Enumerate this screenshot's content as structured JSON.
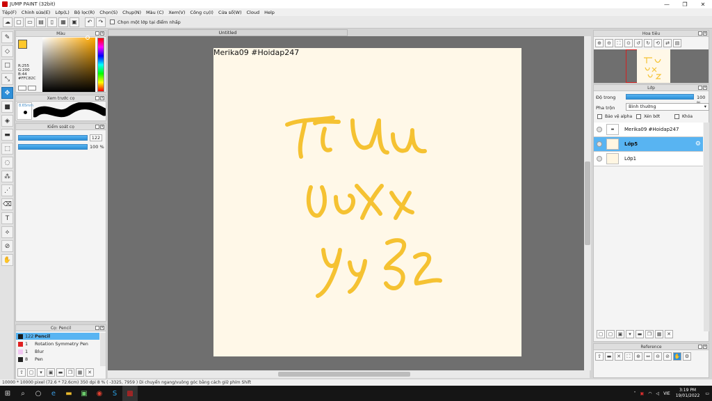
{
  "window": {
    "title": "JUMP PAINT (32bit)",
    "minimize": "—",
    "maximize": "❐",
    "close": "✕"
  },
  "menu": [
    "Tệp(F)",
    "Chỉnh sửa(E)",
    "Lớp(L)",
    "Bộ lọc(R)",
    "Chọn(S)",
    "Chụp(N)",
    "Màu (C)",
    "Xem(V)",
    "Công cụ(I)",
    "Cửa sổ(W)",
    "Cloud",
    "Help"
  ],
  "toolbar": {
    "checkbox_label": "Chọn một lớp tại điểm nhấp"
  },
  "color_panel": {
    "title": "Màu",
    "readout": [
      "R:255",
      "G:200",
      "B:44",
      "#FFC82C"
    ],
    "current_color": "#FFC82C"
  },
  "brush_preview": {
    "title": "Xem trước cọ",
    "size_label": "8.65mm"
  },
  "brush_control": {
    "title": "Kiểm soát cọ",
    "size_value": "122",
    "size_fraction": 0.95,
    "opacity_value": "100 %",
    "opacity_fraction": 1.0
  },
  "brush_list": {
    "title": "Cọ: Pencil",
    "items": [
      {
        "size": "122",
        "name": "Pencil",
        "color": "#1a1a1a",
        "selected": true
      },
      {
        "size": "1",
        "name": "Rotation Symmetry Pen",
        "color": "#e02020",
        "selected": false
      },
      {
        "size": "1",
        "name": "Blur",
        "color": "#f2c6f2",
        "selected": false
      },
      {
        "size": "8",
        "name": "Pen",
        "color": "#222222",
        "selected": false
      }
    ]
  },
  "document": {
    "tab_title": "Untitled",
    "canvas_text": "Merika09 #Hoidap247",
    "handwriting_lines": [
      "Tt Uu",
      "Vv Xx",
      "Yy Zz"
    ],
    "ink_color": "#F5C232"
  },
  "navigator": {
    "title": "Hoa tiêu"
  },
  "layers": {
    "title": "Lớp",
    "opacity_label": "Độ trong",
    "opacity_value": "100 %",
    "opacity_fraction": 1.0,
    "blend_label": "Pha trộn",
    "blend_value": "Bình thường",
    "protect_alpha": "Bảo vệ alpha",
    "clipping": "Xén bớt",
    "lock": "Khóa",
    "items": [
      {
        "name": "Merika09 #Hoidap247",
        "selected": false
      },
      {
        "name": "Lớp5",
        "selected": true
      },
      {
        "name": "Lớp1",
        "selected": false
      }
    ]
  },
  "reference": {
    "title": "Reference"
  },
  "statusbar": {
    "text": "10000 * 10000 pixel   (72.6 * 72.6cm)   350 dpi   8 %   ( -3325, 7959 )   Di chuyển ngang/vuông góc bằng cách giữ phím Shift"
  },
  "taskbar": {
    "lang": "VIE",
    "time": "3:19 PM",
    "date": "19/01/2022"
  }
}
